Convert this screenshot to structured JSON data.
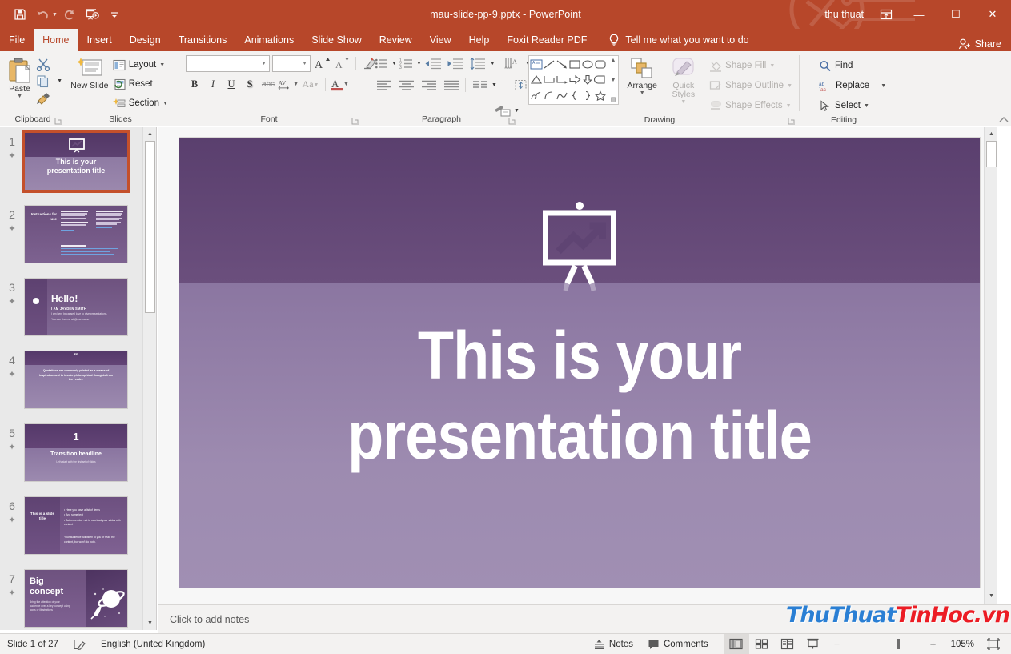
{
  "titlebar": {
    "quick_access": [
      {
        "name": "save",
        "icon": "save-icon"
      },
      {
        "name": "undo",
        "icon": "undo-icon"
      },
      {
        "name": "redo",
        "icon": "redo-icon"
      },
      {
        "name": "start-from-beginning",
        "icon": "slideshow-icon"
      },
      {
        "name": "customize-quick-access-toolbar",
        "icon": "chevron-down-icon"
      }
    ],
    "document_title": "mau-slide-pp-9.pptx  -  PowerPoint",
    "user_name": "thu thuat",
    "ribbon_display_options": "ribbon-display-icon",
    "minimize": "—",
    "maximize": "☐",
    "close": "✕"
  },
  "tabs": [
    {
      "label": "File",
      "active": false
    },
    {
      "label": "Home",
      "active": true
    },
    {
      "label": "Insert",
      "active": false
    },
    {
      "label": "Design",
      "active": false
    },
    {
      "label": "Transitions",
      "active": false
    },
    {
      "label": "Animations",
      "active": false
    },
    {
      "label": "Slide Show",
      "active": false
    },
    {
      "label": "Review",
      "active": false
    },
    {
      "label": "View",
      "active": false
    },
    {
      "label": "Help",
      "active": false
    },
    {
      "label": "Foxit Reader PDF",
      "active": false
    }
  ],
  "tellme": {
    "icon": "lightbulb-icon",
    "placeholder": "Tell me what you want to do"
  },
  "share": {
    "label": "Share",
    "icon": "share-person-icon"
  },
  "ribbon": {
    "groups": [
      {
        "name": "clipboard",
        "label": "Clipboard",
        "paste_label": "Paste",
        "items": [
          {
            "label": "Cut",
            "icon": "scissors-icon"
          },
          {
            "label": "Copy",
            "icon": "copy-icon"
          },
          {
            "label": "Format Painter",
            "icon": "format-painter-icon"
          }
        ]
      },
      {
        "name": "slides",
        "label": "Slides",
        "new_slide_label": "New Slide",
        "items": [
          {
            "label": "Layout",
            "icon": "layout-icon"
          },
          {
            "label": "Reset",
            "icon": "reset-icon"
          },
          {
            "label": "Section",
            "icon": "section-icon"
          }
        ]
      },
      {
        "name": "font",
        "label": "Font",
        "font_name_value": "",
        "font_size_value": "",
        "buttons": [
          {
            "label": "B",
            "name": "bold"
          },
          {
            "label": "I",
            "name": "italic"
          },
          {
            "label": "U",
            "name": "underline"
          },
          {
            "label": "S",
            "name": "text-shadow"
          },
          {
            "label": "abc",
            "name": "strikethrough"
          },
          {
            "label": "AV",
            "name": "character-spacing"
          },
          {
            "label": "Aa",
            "name": "change-case"
          },
          {
            "label": "A",
            "name": "font-color"
          }
        ],
        "grow_font": "A",
        "shrink_font": "A",
        "clear_formatting": "clear-formatting-icon"
      },
      {
        "name": "paragraph",
        "label": "Paragraph"
      },
      {
        "name": "drawing",
        "label": "Drawing",
        "arrange_label": "Arrange",
        "quick_styles_label": "Quick Styles",
        "shape_fill_label": "Shape Fill",
        "shape_outline_label": "Shape Outline",
        "shape_effects_label": "Shape Effects"
      },
      {
        "name": "editing",
        "label": "Editing",
        "find_label": "Find",
        "replace_label": "Replace",
        "select_label": "Select"
      }
    ]
  },
  "slide_panel": {
    "thumbnails": [
      {
        "number": "1",
        "selected": true,
        "has_animation": true,
        "kind": "title",
        "title_line1": "This is your",
        "title_line2": "presentation title"
      },
      {
        "number": "2",
        "selected": false,
        "has_animation": true,
        "kind": "instructions",
        "title": "Instructions for use"
      },
      {
        "number": "3",
        "selected": false,
        "has_animation": true,
        "kind": "hello",
        "title": "Hello!",
        "sub1": "I AM JAYDEN SMITH",
        "sub2": "I am here because I love to give presentations.",
        "sub3": "You can find me at @username"
      },
      {
        "number": "4",
        "selected": false,
        "has_animation": true,
        "kind": "quote",
        "mark": "“",
        "text": "Quotations are commonly printed as a means of inspiration and to invoke philosophical thoughts from the reader."
      },
      {
        "number": "5",
        "selected": false,
        "has_animation": true,
        "kind": "transition",
        "big": "1",
        "title": "Transition headline",
        "sub": "Let's start with the first set of slides"
      },
      {
        "number": "6",
        "selected": false,
        "has_animation": true,
        "kind": "bullets",
        "title": "This is a slide title",
        "bullets": [
          "Here you have a list of items",
          "And some text",
          "But remember not to overload your slides with content"
        ],
        "footer": "Your audience will listen to you or read the content, but won't do both."
      },
      {
        "number": "7",
        "selected": false,
        "has_animation": true,
        "kind": "bigconcept",
        "title_line1": "Big",
        "title_line2": "concept",
        "sub": "Bring the attention of your audience over a key concept using icons or illustrations"
      }
    ]
  },
  "slide": {
    "icon_name": "presentation-chart-icon",
    "title_line1": "This is your",
    "title_line2": "presentation title",
    "colors": {
      "top_gradient_start": "#5a3f6e",
      "top_gradient_end": "#6b4f7d",
      "bottom_gradient_start": "#8b76a1",
      "bottom_gradient_end": "#a08fb3",
      "title_color": "#ffffff"
    }
  },
  "notes": {
    "placeholder": "Click to add notes"
  },
  "watermark": {
    "part_blue": "ThuThuat",
    "part_red": "TinHoc.vn",
    "blue_hex": "#2a7fd4",
    "red_hex": "#ec1c24"
  },
  "statusbar": {
    "slide_counter": "Slide 1 of 27",
    "spellcheck_icon": "spellcheck-icon",
    "language": "English (United Kingdom)",
    "notes_label": "Notes",
    "comments_label": "Comments",
    "views": [
      {
        "name": "normal-view",
        "active": true
      },
      {
        "name": "slide-sorter-view",
        "active": false
      },
      {
        "name": "reading-view",
        "active": false
      },
      {
        "name": "slide-show-view",
        "active": false
      }
    ],
    "zoom_out": "−",
    "zoom_in": "+",
    "zoom_level": "105%",
    "fit_to_window": "fit-slide-icon"
  },
  "theme": {
    "accent": "#b7472a",
    "ribbon_bg": "#f3f2f1"
  }
}
